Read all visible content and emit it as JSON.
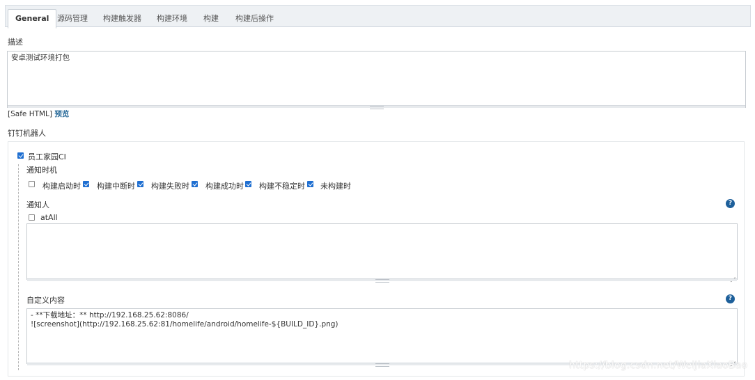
{
  "tabs": [
    "General",
    "源码管理",
    "构建触发器",
    "构建环境",
    "构建",
    "构建后操作"
  ],
  "description": {
    "label": "描述",
    "value": "安卓测试环境打包",
    "safe_html": "[Safe HTML]",
    "preview_link": "预览"
  },
  "dingtalk": {
    "section_label": "钉钉机器人",
    "robot": {
      "name": "员工家园CI",
      "checked": true
    },
    "notify_time": {
      "label": "通知时机",
      "options": [
        {
          "label": "构建启动时",
          "checked": false
        },
        {
          "label": "构建中断时",
          "checked": true
        },
        {
          "label": "构建失败时",
          "checked": true
        },
        {
          "label": "构建成功时",
          "checked": true
        },
        {
          "label": "构建不稳定时",
          "checked": true
        },
        {
          "label": "未构建时",
          "checked": true
        }
      ]
    },
    "notify_people": {
      "label": "通知人",
      "atall_label": "atAll",
      "atall_checked": false,
      "value": "",
      "help": "?"
    },
    "custom_content": {
      "label": "自定义内容",
      "line1": "- **下载地址：** http://192.168.25.62:8086/",
      "line2": "![screenshot](http://192.168.25.62:81/homelife/android/homelife-${BUILD_ID}.png)",
      "help": "?"
    }
  },
  "watermark": "https://blog.csdn.net/WeiJiaXiaoBao",
  "colors": {
    "accent": "#1f6fd1",
    "link": "#2a6b9a",
    "help_icon": "#1d5f9a"
  }
}
